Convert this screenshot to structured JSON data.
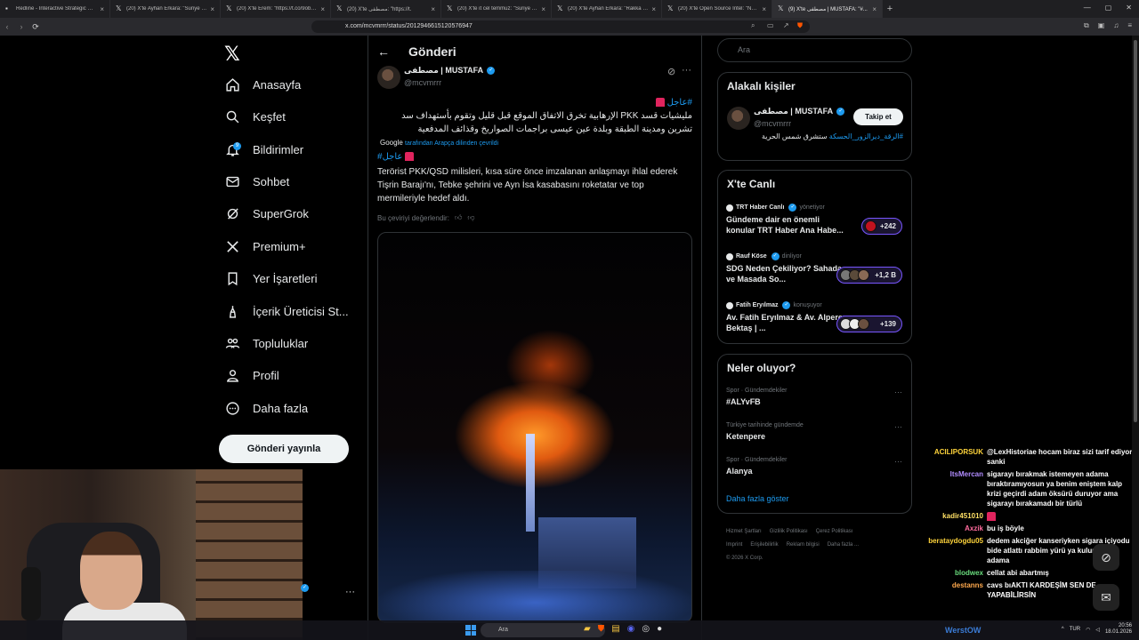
{
  "browser": {
    "tabs": [
      {
        "title": "Redline - Interactive Strategic Map",
        "active": false
      },
      {
        "title": "(20) X'te Ayhan Erkara: \"Suriye ordusu",
        "active": false
      },
      {
        "title": "(20) X'te Erem: \"https://t.co/9obqVar",
        "active": false
      },
      {
        "title": "(20) X'te مصطفى: \"https://t.",
        "active": false
      },
      {
        "title": "(20) X'te it cel temmuz: \"Suriye Doğu",
        "active": false
      },
      {
        "title": "(20) X'te Ayhan Erkara: \"Rakka hala",
        "active": false
      },
      {
        "title": "(20) X'te Open Source Intel: \"NEW",
        "active": false
      },
      {
        "title": "(9) X'te مصطفى | MUSTAFA: \"#...",
        "active": true
      }
    ],
    "url": "x.com/mcvmrrr/status/2012946615120576947"
  },
  "sidebar": {
    "items": [
      {
        "label": "Anasayfa",
        "icon": "home-icon"
      },
      {
        "label": "Keşfet",
        "icon": "search-icon"
      },
      {
        "label": "Bildirimler",
        "icon": "bell-icon",
        "badge": "9"
      },
      {
        "label": "Sohbet",
        "icon": "mail-icon"
      },
      {
        "label": "SuperGrok",
        "icon": "grok-icon"
      },
      {
        "label": "Premium+",
        "icon": "x-icon"
      },
      {
        "label": "Yer İşaretleri",
        "icon": "bookmark-icon"
      },
      {
        "label": "İçerik Üreticisi St...",
        "icon": "creator-icon"
      },
      {
        "label": "Topluluklar",
        "icon": "communities-icon"
      },
      {
        "label": "Profil",
        "icon": "profile-icon"
      },
      {
        "label": "Daha fazla",
        "icon": "more-circle-icon"
      }
    ],
    "post_button": "Gönderi yayınla"
  },
  "post": {
    "page_title": "Gönderi",
    "author_name": "مصطفى | MUSTAFA",
    "author_handle": "@mcvmrrr",
    "hashtag_ar": "#عاجل",
    "text_ar": "مليشيات قسد PKK الإرهابية تخرق الاتفاق الموقع قبل قليل وتقوم بأستهداف سد تشرين ومدينة الطبقة وبلدة عين عيسى براجمات الصواريخ وقذائف المدفعية",
    "translated_prefix": "Google",
    "translated_suffix": "tarafından Arapça dilinden çevrildi",
    "hashtag_tr": "#عاجل",
    "text_tr": "Terörist PKK/QSD milisleri, kısa süre önce imzalanan anlaşmayı ihlal ederek Tişrin Barajı'nı, Tebke şehrini ve Ayn İsa kasabasını roketatar ve top mermileriyle hedef aldı.",
    "rate_translation": "Bu çeviriyi değerlendir:"
  },
  "right": {
    "search_placeholder": "Ara",
    "related_title": "Alakalı kişiler",
    "related": {
      "name": "مصطفى | MUSTAFA",
      "handle": "@mcvmrrr",
      "follow": "Takip et",
      "bio_hashtag": "#الرقة_ديرالزور_الحسكة",
      "bio_text": "ستشرق شمس الحرية"
    },
    "live_title": "X'te Canlı",
    "live": [
      {
        "host": "TRT Haber Canlı",
        "role": "yönetiyor",
        "title": "Gündeme dair en önemli konular TRT Haber Ana Habe...",
        "count": "+242"
      },
      {
        "host": "Rauf Köse",
        "role": "dinliyor",
        "title": "SDG Neden Çekiliyor? Sahada ve Masada So...",
        "count": "+1,2 B"
      },
      {
        "host": "Fatih Eryılmaz",
        "role": "konuşuyor",
        "title": "Av. Fatih Eryılmaz & Av. Alperen Bektaş | ...",
        "count": "+139"
      }
    ],
    "trends_title": "Neler oluyor?",
    "trends": [
      {
        "context": "Spor · Gündemdekiler",
        "name": "#ALYvFB"
      },
      {
        "context": "Türkiye tarihinde gündemde",
        "name": "Ketenpere"
      },
      {
        "context": "Spor · Gündemdekiler",
        "name": "Alanya"
      }
    ],
    "show_more": "Daha fazla göster",
    "footer": [
      "Hizmet Şartları",
      "Gizlilik Politikası",
      "Çerez Politikası",
      "Imprint",
      "Erişilebilirlik",
      "Reklam bilgisi",
      "Daha fazla ...",
      "© 2026 X Corp."
    ]
  },
  "chat": [
    {
      "user": "ACILIPORSUK",
      "color": "#ffd43b",
      "text": "@LexHistoriae hocam biraz sizi tarif ediyor sanki"
    },
    {
      "user": "ItsMercan",
      "color": "#b18cff",
      "text": "sigarayı bırakmak istemeyen adama bıraktıramıyosun ya benim eniştem kalp krizi geçirdi adam öksürü duruyor ama sigarayı bırakamadı bir türlü"
    },
    {
      "user": "kadir451010",
      "color": "#ffe066",
      "text": ""
    },
    {
      "user": "Axzik",
      "color": "#ff6b9d",
      "text": "bu iş böyle"
    },
    {
      "user": "berataydogdu05",
      "color": "#ffd43b",
      "text": "dedem akciğer kanseriyken sigara içiyodu bide atlattı rabbim yürü ya kulum dedi adama"
    },
    {
      "user": "blodwex",
      "color": "#69db7c",
      "text": "cellat abi abartmış"
    },
    {
      "user": "destanns",
      "color": "#ffa94d",
      "text": "cavs bıAKTI KARDEŞİM SEN DE YAPABİLİRSİN"
    }
  ],
  "taskbar": {
    "search": "Ara",
    "lang": "TUR",
    "time": "20:56",
    "date": "18.01.2026",
    "streamer": "WerstOW"
  },
  "colors": {
    "accent": "#1d9bf0",
    "live_ring": "#7856ff",
    "background": "#000000"
  }
}
